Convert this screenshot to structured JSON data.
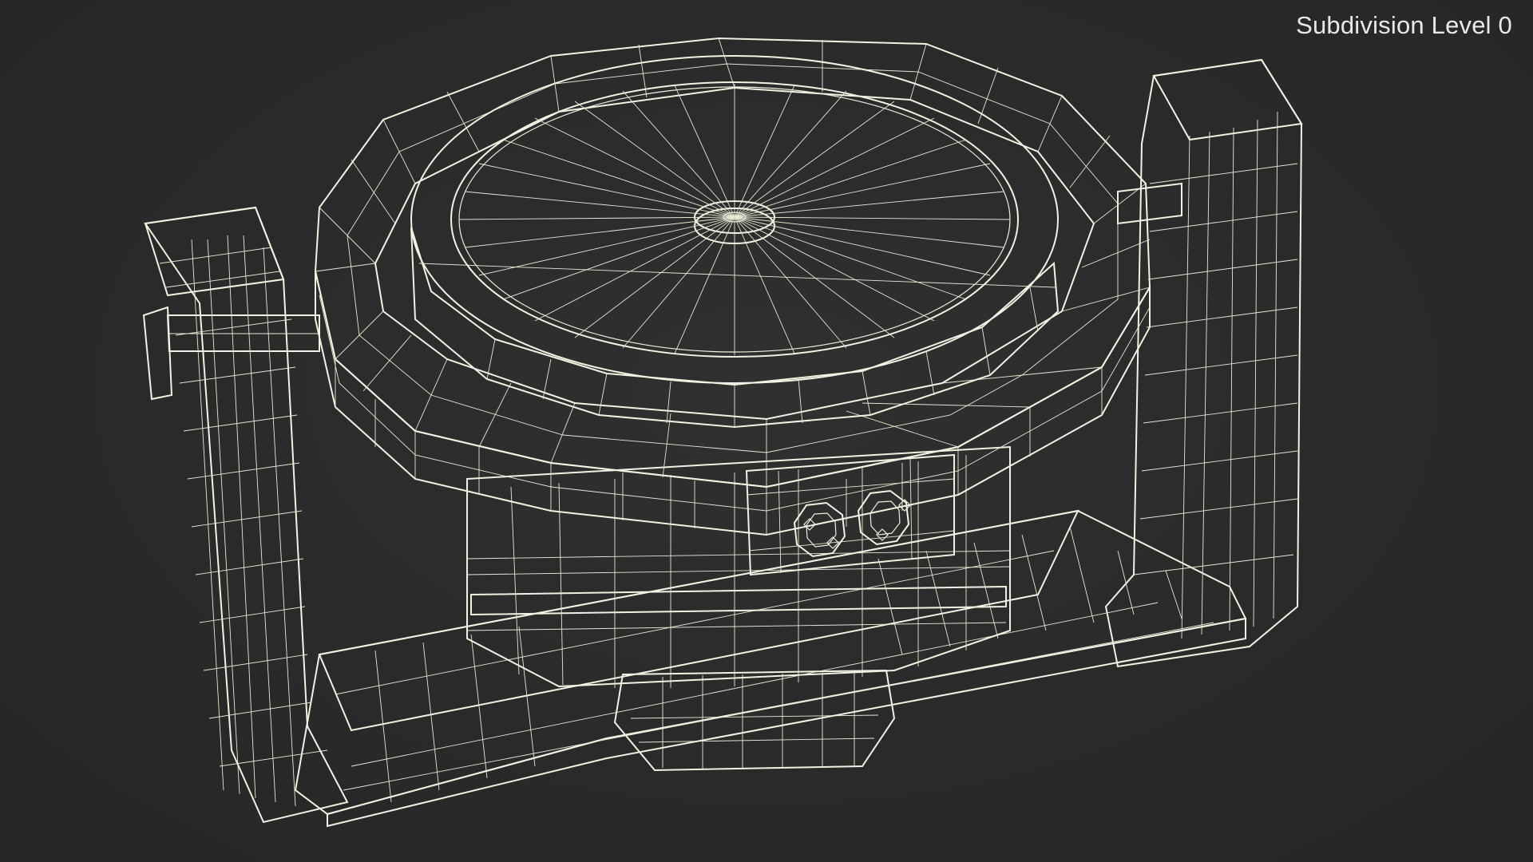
{
  "viewport": {
    "subdivision_label": "Subdivision Level 0"
  },
  "colors": {
    "background": "#2a2a2a",
    "surface": "#7e7e72",
    "wireframe": "#eeeede",
    "label_text": "#e9e9e9"
  }
}
